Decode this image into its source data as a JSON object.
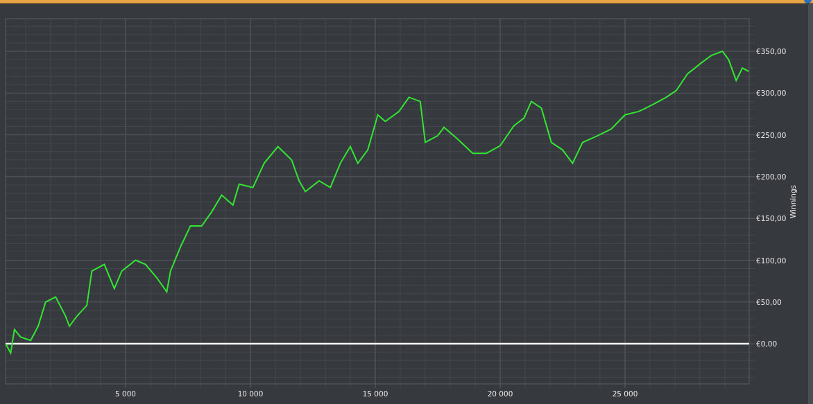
{
  "chart": {
    "chart_data": {
      "type": "line",
      "ylabel": "Winnings",
      "grid": true,
      "xlim": [
        194,
        29972
      ],
      "ylim": [
        -48,
        389
      ],
      "xticks": [
        {
          "value": 5000,
          "label": "5 000"
        },
        {
          "value": 10000,
          "label": "10 000"
        },
        {
          "value": 15000,
          "label": "15 000"
        },
        {
          "value": 20000,
          "label": "20 000"
        },
        {
          "value": 25000,
          "label": "25 000"
        }
      ],
      "yticks": [
        {
          "value": 0,
          "label": "€0,00"
        },
        {
          "value": 50,
          "label": "€50,00"
        },
        {
          "value": 100,
          "label": "€100,00"
        },
        {
          "value": 150,
          "label": "€150,00"
        },
        {
          "value": 200,
          "label": "€200,00"
        },
        {
          "value": 250,
          "label": "€250,00"
        },
        {
          "value": 300,
          "label": "€300,00"
        },
        {
          "value": 350,
          "label": "€350,00"
        }
      ],
      "x": [
        200,
        400,
        550,
        800,
        1200,
        1500,
        1800,
        2200,
        2600,
        2750,
        3050,
        3450,
        3650,
        4150,
        4550,
        4850,
        5400,
        5800,
        6250,
        6650,
        6800,
        7200,
        7600,
        8050,
        8450,
        8850,
        9300,
        9550,
        10100,
        10550,
        11100,
        11650,
        11950,
        12200,
        12750,
        13200,
        13600,
        14000,
        14300,
        14700,
        15100,
        15400,
        15950,
        16350,
        16800,
        17000,
        17500,
        17750,
        18300,
        18900,
        19450,
        20000,
        20550,
        20950,
        21250,
        21650,
        22050,
        22500,
        22900,
        23300,
        23900,
        24450,
        25000,
        25550,
        26100,
        26650,
        27050,
        27500,
        28050,
        28450,
        28900,
        29150,
        29450,
        29700,
        29950
      ],
      "series": [
        {
          "color": "#33e533",
          "values": [
            0,
            -11,
            17,
            8,
            4,
            21,
            50,
            56,
            33,
            21,
            33,
            46,
            87,
            95,
            66,
            87,
            100,
            95,
            79,
            62,
            87,
            116,
            141,
            141,
            158,
            178,
            166,
            191,
            187,
            216,
            236,
            220,
            195,
            182,
            195,
            187,
            216,
            236,
            216,
            232,
            274,
            266,
            278,
            295,
            290,
            241,
            249,
            259,
            245,
            228,
            228,
            237,
            261,
            270,
            290,
            282,
            241,
            232,
            216,
            241,
            249,
            257,
            274,
            278,
            286,
            295,
            303,
            323,
            336,
            345,
            350,
            340,
            315,
            330,
            326
          ]
        }
      ]
    }
  }
}
